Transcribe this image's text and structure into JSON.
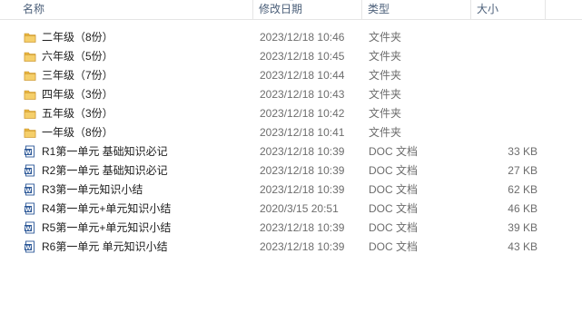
{
  "columns": {
    "name": "名称",
    "date": "修改日期",
    "type": "类型",
    "size": "大小"
  },
  "files": [
    {
      "name": "二年级（8份）",
      "date": "2023/12/18 10:46",
      "type": "文件夹",
      "size": "",
      "icon": "folder-icon"
    },
    {
      "name": "六年级（5份）",
      "date": "2023/12/18 10:45",
      "type": "文件夹",
      "size": "",
      "icon": "folder-icon"
    },
    {
      "name": "三年级（7份）",
      "date": "2023/12/18 10:44",
      "type": "文件夹",
      "size": "",
      "icon": "folder-icon"
    },
    {
      "name": "四年级（3份）",
      "date": "2023/12/18 10:43",
      "type": "文件夹",
      "size": "",
      "icon": "folder-icon"
    },
    {
      "name": "五年级（3份）",
      "date": "2023/12/18 10:42",
      "type": "文件夹",
      "size": "",
      "icon": "folder-icon"
    },
    {
      "name": "一年级（8份）",
      "date": "2023/12/18 10:41",
      "type": "文件夹",
      "size": "",
      "icon": "folder-icon"
    },
    {
      "name": "R1第一单元 基础知识必记",
      "date": "2023/12/18 10:39",
      "type": "DOC 文档",
      "size": "33 KB",
      "icon": "doc-icon"
    },
    {
      "name": "R2第一单元 基础知识必记",
      "date": "2023/12/18 10:39",
      "type": "DOC 文档",
      "size": "27 KB",
      "icon": "doc-icon"
    },
    {
      "name": "R3第一单元知识小结",
      "date": "2023/12/18 10:39",
      "type": "DOC 文档",
      "size": "62 KB",
      "icon": "doc-icon"
    },
    {
      "name": "R4第一单元+单元知识小结",
      "date": "2020/3/15 20:51",
      "type": "DOC 文档",
      "size": "46 KB",
      "icon": "doc-icon"
    },
    {
      "name": "R5第一单元+单元知识小结",
      "date": "2023/12/18 10:39",
      "type": "DOC 文档",
      "size": "39 KB",
      "icon": "doc-icon"
    },
    {
      "name": "R6第一单元 单元知识小结",
      "date": "2023/12/18 10:39",
      "type": "DOC 文档",
      "size": "43 KB",
      "icon": "doc-icon"
    }
  ],
  "colors": {
    "folder": "#e8b53e",
    "doc": "#2b5797",
    "header_text": "#4c607a"
  }
}
